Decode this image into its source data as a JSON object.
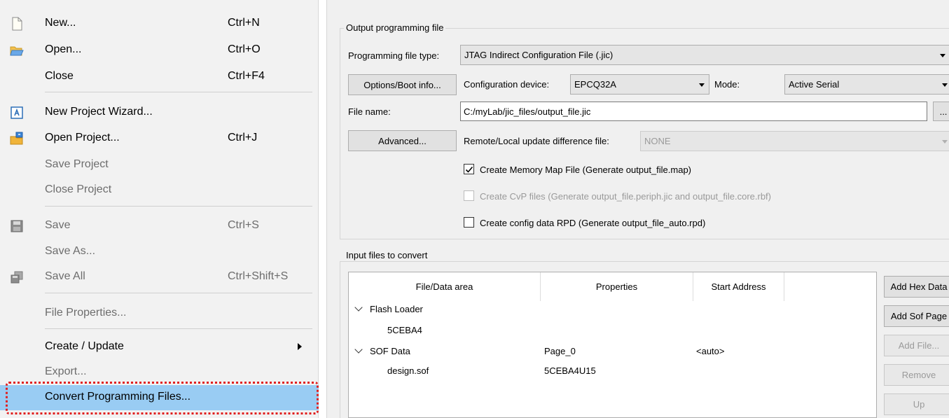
{
  "menu": {
    "items": [
      {
        "label": "New...",
        "shortcut": "Ctrl+N",
        "icon": "new-file-icon"
      },
      {
        "label": "Open...",
        "shortcut": "Ctrl+O",
        "icon": "open-folder-icon"
      },
      {
        "label": "Close",
        "shortcut": "Ctrl+F4"
      },
      {
        "label": "New Project Wizard...",
        "shortcut": "",
        "icon": "wizard-icon"
      },
      {
        "label": "Open Project...",
        "shortcut": "Ctrl+J",
        "icon": "open-project-icon"
      },
      {
        "label": "Save Project",
        "shortcut": ""
      },
      {
        "label": "Close Project",
        "shortcut": ""
      },
      {
        "label": "Save",
        "shortcut": "Ctrl+S",
        "icon": "save-icon"
      },
      {
        "label": "Save As...",
        "shortcut": ""
      },
      {
        "label": "Save All",
        "shortcut": "Ctrl+Shift+S",
        "icon": "save-all-icon"
      },
      {
        "label": "File Properties...",
        "shortcut": ""
      },
      {
        "label": "Create / Update",
        "shortcut": ""
      },
      {
        "label": "Export...",
        "shortcut": ""
      },
      {
        "label": "Convert Programming Files...",
        "shortcut": ""
      }
    ]
  },
  "dialog": {
    "output_group_title": "Output programming file",
    "prog_file_type_label": "Programming file type:",
    "prog_file_type_value": "JTAG Indirect Configuration File (.jic)",
    "options_button": "Options/Boot info...",
    "config_device_label": "Configuration device:",
    "config_device_value": "EPCQ32A",
    "mode_label": "Mode:",
    "mode_value": "Active Serial",
    "file_name_label": "File name:",
    "file_name_value": "C:/myLab/jic_files/output_file.jic",
    "browse_button": "...",
    "advanced_button": "Advanced...",
    "remote_label": "Remote/Local update difference file:",
    "remote_value": "NONE",
    "cb_memory_map": "Create Memory Map File (Generate output_file.map)",
    "cb_cvp": "Create CvP files (Generate output_file.periph.jic and output_file.core.rbf)",
    "cb_rpd": "Create config data RPD (Generate output_file_auto.rpd)",
    "input_group_title": "Input files to convert",
    "columns": [
      "File/Data area",
      "Properties",
      "Start Address"
    ],
    "rows": [
      {
        "file": "Flash Loader",
        "properties": "",
        "start": ""
      },
      {
        "file": "5CEBA4",
        "properties": "",
        "start": ""
      },
      {
        "file": "SOF Data",
        "properties": "Page_0",
        "start": "<auto>"
      },
      {
        "file": "design.sof",
        "properties": "5CEBA4U15",
        "start": ""
      }
    ],
    "side_buttons": [
      "Add Hex Data",
      "Add Sof Page",
      "Add File...",
      "Remove",
      "Up"
    ]
  },
  "colors": {
    "highlight": "#99ccf3",
    "annotation_border": "#e02020",
    "menu_bg": "#f2f2f2",
    "dialog_bg": "#f0f0f0"
  }
}
